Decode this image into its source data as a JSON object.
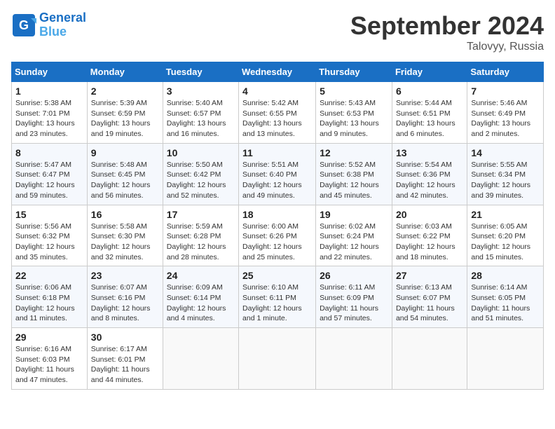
{
  "header": {
    "logo_line1": "General",
    "logo_line2": "Blue",
    "month": "September 2024",
    "location": "Talovyy, Russia"
  },
  "weekdays": [
    "Sunday",
    "Monday",
    "Tuesday",
    "Wednesday",
    "Thursday",
    "Friday",
    "Saturday"
  ],
  "weeks": [
    [
      {
        "day": "1",
        "info": "Sunrise: 5:38 AM\nSunset: 7:01 PM\nDaylight: 13 hours\nand 23 minutes."
      },
      {
        "day": "2",
        "info": "Sunrise: 5:39 AM\nSunset: 6:59 PM\nDaylight: 13 hours\nand 19 minutes."
      },
      {
        "day": "3",
        "info": "Sunrise: 5:40 AM\nSunset: 6:57 PM\nDaylight: 13 hours\nand 16 minutes."
      },
      {
        "day": "4",
        "info": "Sunrise: 5:42 AM\nSunset: 6:55 PM\nDaylight: 13 hours\nand 13 minutes."
      },
      {
        "day": "5",
        "info": "Sunrise: 5:43 AM\nSunset: 6:53 PM\nDaylight: 13 hours\nand 9 minutes."
      },
      {
        "day": "6",
        "info": "Sunrise: 5:44 AM\nSunset: 6:51 PM\nDaylight: 13 hours\nand 6 minutes."
      },
      {
        "day": "7",
        "info": "Sunrise: 5:46 AM\nSunset: 6:49 PM\nDaylight: 13 hours\nand 2 minutes."
      }
    ],
    [
      {
        "day": "8",
        "info": "Sunrise: 5:47 AM\nSunset: 6:47 PM\nDaylight: 12 hours\nand 59 minutes."
      },
      {
        "day": "9",
        "info": "Sunrise: 5:48 AM\nSunset: 6:45 PM\nDaylight: 12 hours\nand 56 minutes."
      },
      {
        "day": "10",
        "info": "Sunrise: 5:50 AM\nSunset: 6:42 PM\nDaylight: 12 hours\nand 52 minutes."
      },
      {
        "day": "11",
        "info": "Sunrise: 5:51 AM\nSunset: 6:40 PM\nDaylight: 12 hours\nand 49 minutes."
      },
      {
        "day": "12",
        "info": "Sunrise: 5:52 AM\nSunset: 6:38 PM\nDaylight: 12 hours\nand 45 minutes."
      },
      {
        "day": "13",
        "info": "Sunrise: 5:54 AM\nSunset: 6:36 PM\nDaylight: 12 hours\nand 42 minutes."
      },
      {
        "day": "14",
        "info": "Sunrise: 5:55 AM\nSunset: 6:34 PM\nDaylight: 12 hours\nand 39 minutes."
      }
    ],
    [
      {
        "day": "15",
        "info": "Sunrise: 5:56 AM\nSunset: 6:32 PM\nDaylight: 12 hours\nand 35 minutes."
      },
      {
        "day": "16",
        "info": "Sunrise: 5:58 AM\nSunset: 6:30 PM\nDaylight: 12 hours\nand 32 minutes."
      },
      {
        "day": "17",
        "info": "Sunrise: 5:59 AM\nSunset: 6:28 PM\nDaylight: 12 hours\nand 28 minutes."
      },
      {
        "day": "18",
        "info": "Sunrise: 6:00 AM\nSunset: 6:26 PM\nDaylight: 12 hours\nand 25 minutes."
      },
      {
        "day": "19",
        "info": "Sunrise: 6:02 AM\nSunset: 6:24 PM\nDaylight: 12 hours\nand 22 minutes."
      },
      {
        "day": "20",
        "info": "Sunrise: 6:03 AM\nSunset: 6:22 PM\nDaylight: 12 hours\nand 18 minutes."
      },
      {
        "day": "21",
        "info": "Sunrise: 6:05 AM\nSunset: 6:20 PM\nDaylight: 12 hours\nand 15 minutes."
      }
    ],
    [
      {
        "day": "22",
        "info": "Sunrise: 6:06 AM\nSunset: 6:18 PM\nDaylight: 12 hours\nand 11 minutes."
      },
      {
        "day": "23",
        "info": "Sunrise: 6:07 AM\nSunset: 6:16 PM\nDaylight: 12 hours\nand 8 minutes."
      },
      {
        "day": "24",
        "info": "Sunrise: 6:09 AM\nSunset: 6:14 PM\nDaylight: 12 hours\nand 4 minutes."
      },
      {
        "day": "25",
        "info": "Sunrise: 6:10 AM\nSunset: 6:11 PM\nDaylight: 12 hours\nand 1 minute."
      },
      {
        "day": "26",
        "info": "Sunrise: 6:11 AM\nSunset: 6:09 PM\nDaylight: 11 hours\nand 57 minutes."
      },
      {
        "day": "27",
        "info": "Sunrise: 6:13 AM\nSunset: 6:07 PM\nDaylight: 11 hours\nand 54 minutes."
      },
      {
        "day": "28",
        "info": "Sunrise: 6:14 AM\nSunset: 6:05 PM\nDaylight: 11 hours\nand 51 minutes."
      }
    ],
    [
      {
        "day": "29",
        "info": "Sunrise: 6:16 AM\nSunset: 6:03 PM\nDaylight: 11 hours\nand 47 minutes."
      },
      {
        "day": "30",
        "info": "Sunrise: 6:17 AM\nSunset: 6:01 PM\nDaylight: 11 hours\nand 44 minutes."
      },
      {
        "day": "",
        "info": ""
      },
      {
        "day": "",
        "info": ""
      },
      {
        "day": "",
        "info": ""
      },
      {
        "day": "",
        "info": ""
      },
      {
        "day": "",
        "info": ""
      }
    ]
  ]
}
